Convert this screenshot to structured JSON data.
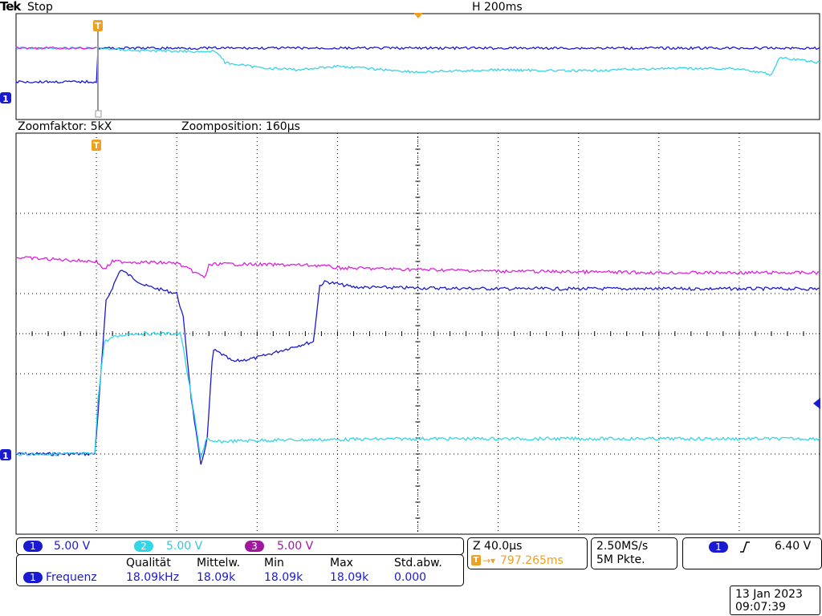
{
  "header": {
    "brand": "Tek",
    "run_state": "Stop",
    "horizontal": "H 200ms"
  },
  "zoom_bar": {
    "factor": "Zoomfaktor: 5kX",
    "position": "Zoomposition: 160µs"
  },
  "trigger_marker": "T",
  "channel_marker": "1",
  "channels": [
    {
      "id": "1",
      "scale": "5.00 V",
      "color": "#1a1ad0"
    },
    {
      "id": "2",
      "scale": "5.00 V",
      "color": "#33d6e6"
    },
    {
      "id": "3",
      "scale": "5.00 V",
      "color": "#a0189e"
    }
  ],
  "measurements": {
    "channel": "1",
    "label": "Frequenz",
    "headers": [
      "Qualität",
      "Mittelw.",
      "Min",
      "Max",
      "Std.abw."
    ],
    "values": [
      "18.09kHz",
      "18.09k",
      "18.09k",
      "18.09k",
      "0.000"
    ]
  },
  "zoom_info": {
    "scale": "Z 40.0µs",
    "trigger_pos": "797.265ms"
  },
  "acquisition": {
    "rate": "2.50MS/s",
    "record": "5M Pkte."
  },
  "trigger_info": {
    "source": "1",
    "level": "6.40 V"
  },
  "timestamp": {
    "date": "13 Jan  2023",
    "time": "09:07:39"
  },
  "colors": {
    "ch1": "#1a1ad0",
    "ch2": "#33d6e6",
    "ch3": "#dd22dd",
    "trigger": "#f0a020",
    "grid": "#000000"
  },
  "chart_data": [
    {
      "type": "line",
      "name": "overview",
      "x_range_divisions": [
        0,
        10
      ],
      "grid": false,
      "series": [
        {
          "name": "1",
          "x": [
            0,
            1,
            1.02,
            10
          ],
          "y": [
            -0.6,
            -0.6,
            0.8,
            0.8
          ]
        },
        {
          "name": "2",
          "x": [
            0,
            1.02,
            1.5,
            2.5,
            2.6,
            3.0,
            3.5,
            4.0,
            5.0,
            6.0,
            7.0,
            8.0,
            9.0,
            9.4,
            9.5,
            10
          ],
          "y": [
            0.8,
            0.8,
            0.7,
            0.65,
            0.2,
            0.0,
            -0.1,
            0.05,
            -0.2,
            -0.1,
            -0.15,
            -0.05,
            -0.05,
            -0.3,
            0.4,
            0.2
          ]
        },
        {
          "name": "3",
          "x": [
            0,
            1
          ],
          "y": [
            0.8,
            0.8
          ]
        }
      ]
    },
    {
      "type": "line",
      "name": "zoom",
      "divisions": {
        "x": 10,
        "y": 5
      },
      "grid": true,
      "time_per_div": "40.0µs",
      "volts_per_div": "5.00 V",
      "series": [
        {
          "name": "1",
          "x": [
            0,
            0.98,
            1.02,
            1.12,
            1.3,
            1.6,
            2.0,
            2.08,
            2.18,
            2.3,
            2.38,
            2.45,
            2.55,
            2.7,
            3.0,
            3.5,
            3.7,
            3.78,
            3.85,
            4.2,
            5,
            6,
            7,
            8,
            9,
            10
          ],
          "y": [
            -1.5,
            -1.5,
            -1.0,
            0.4,
            0.8,
            0.6,
            0.5,
            0.2,
            -0.8,
            -1.65,
            -1.3,
            -0.2,
            -0.25,
            -0.35,
            -0.3,
            -0.15,
            -0.1,
            0.6,
            0.65,
            0.58,
            0.57,
            0.56,
            0.56,
            0.56,
            0.56,
            0.56
          ]
        },
        {
          "name": "2",
          "x": [
            0,
            0.98,
            1.02,
            1.1,
            1.2,
            1.4,
            2.0,
            2.05,
            2.2,
            2.3,
            2.37,
            2.42,
            3,
            4,
            5,
            6,
            7,
            8,
            9,
            10
          ],
          "y": [
            -1.5,
            -1.5,
            -0.8,
            -0.1,
            -0.05,
            0.0,
            0.0,
            0.0,
            -0.9,
            -1.55,
            -1.3,
            -1.35,
            -1.33,
            -1.32,
            -1.31,
            -1.31,
            -1.31,
            -1.31,
            -1.31,
            -1.31
          ]
        },
        {
          "name": "3",
          "x": [
            0,
            1.0,
            1.1,
            1.2,
            2.0,
            2.35,
            2.4,
            2.5,
            3.8,
            4.0,
            5,
            6,
            7,
            8,
            9,
            10
          ],
          "y": [
            0.95,
            0.9,
            0.8,
            0.9,
            0.88,
            0.7,
            0.85,
            0.87,
            0.85,
            0.82,
            0.8,
            0.78,
            0.77,
            0.76,
            0.76,
            0.76
          ]
        }
      ]
    }
  ]
}
